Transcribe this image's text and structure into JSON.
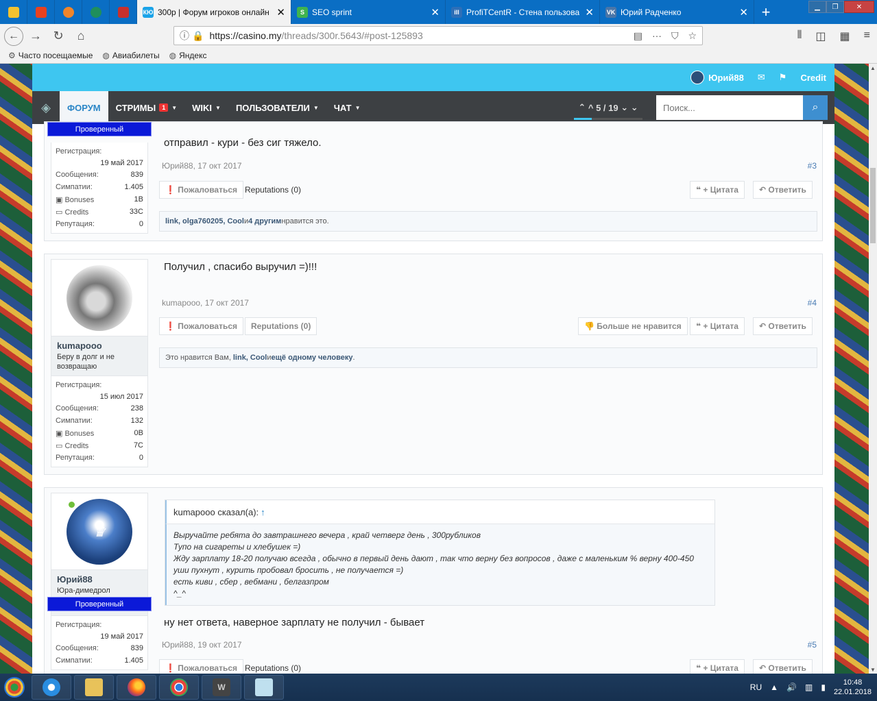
{
  "browser": {
    "tabs": [
      {
        "title": "300р | Форум игроков онлайн",
        "fav": "КЮ",
        "color": "#1aa3e8",
        "active": true
      },
      {
        "title": "SEO sprint",
        "fav": "S",
        "color": "#3fb34f",
        "active": false
      },
      {
        "title": "ProfiTCentR - Стена пользоват",
        "fav": "ill",
        "color": "#2e6fb7",
        "active": false
      },
      {
        "title": "Юрий Радченко",
        "fav": "VK",
        "color": "#4a76a8",
        "active": false
      }
    ],
    "url_host": "https://casino.my",
    "url_path": "/threads/300r.5643/#post-125893",
    "bookmarks": [
      "Часто посещаемые",
      "Авиабилеты",
      "Яндекс"
    ]
  },
  "topbar": {
    "username": "Юрий88",
    "credit": "Credit"
  },
  "menu": {
    "items": [
      {
        "label": "Форум",
        "active": true,
        "badge": "",
        "caret": false
      },
      {
        "label": "Стримы",
        "active": false,
        "badge": "1",
        "caret": true
      },
      {
        "label": "Wiki",
        "active": false,
        "badge": "",
        "caret": true
      },
      {
        "label": "Пользователи",
        "active": false,
        "badge": "",
        "caret": true
      },
      {
        "label": "Чат",
        "active": false,
        "badge": "",
        "caret": true
      }
    ],
    "pager": "5 / 19",
    "pager_progress": 0.26,
    "search_placeholder": "Поиск..."
  },
  "labels": {
    "registration": "Регистрация:",
    "messages": "Сообщения:",
    "likes": "Симпатии:",
    "bonuses": "Bonuses",
    "credits": "Credits",
    "reputation": "Репутация:",
    "report": "Пожаловаться",
    "quote": "+ Цитата",
    "reply": "Ответить",
    "unlike": "Больше не нравится",
    "verified": "Проверенный"
  },
  "posts": [
    {
      "id": "p3",
      "text": "отправил - кури - без сиг тяжело.",
      "author": "Юрий88",
      "date": "17 окт 2017",
      "num": "#3",
      "reputations": "Reputations (0)",
      "likes": {
        "pre": "",
        "names": "link, olga760205, Cool",
        "mid": " и ",
        "others": "4 другим",
        "post": " нравится это."
      },
      "stats": {
        "reg": "19 май 2017",
        "msgs": "839",
        "likes": "1.405",
        "bonuses": "1B",
        "credits": "33C",
        "rep": "0"
      }
    },
    {
      "id": "p4",
      "text": "Получил , спасибо выручил =)!!!",
      "author": "kumapooo",
      "user_title": "Беру в долг и не возвращаю",
      "date": "17 окт 2017",
      "num": "#4",
      "reputations": "Reputations (0)",
      "likes": {
        "pre": "Это нравится Вам, ",
        "names": "link, Cool",
        "mid": " и ",
        "others": "ещё одному человеку",
        "post": "."
      },
      "stats": {
        "reg": "15 июл 2017",
        "msgs": "238",
        "likes": "132",
        "bonuses": "0B",
        "credits": "7C",
        "rep": "0"
      }
    },
    {
      "id": "p5",
      "text": "ну нет ответа, наверное зарплату не получил - бывает",
      "author": "Юрий88",
      "user_title": "Юра-димедрол",
      "date": "19 окт 2017",
      "num": "#5",
      "reputations": "Reputations (0)",
      "quote_head": "kumapooo сказал(а):",
      "quote_lines": [
        "Выручайте ребята до завтрашнего вечера , край четверг день , 300рубликов",
        "Тупо на сигареты и хлебушек =)",
        "Жду зарплату 18-20 получаю всегда , обычно в первый день дают , так что верну без вопросов , даже с маленьким % верну 400-450",
        "уши пухнут , курить пробовал бросить , не получается =)",
        "есть киви , сбер , вебмани , белгазпром",
        "^_^"
      ],
      "stats": {
        "reg": "19 май 2017",
        "msgs": "839",
        "likes": "1.405"
      }
    }
  ],
  "tray": {
    "lang": "RU",
    "time": "10:48",
    "date": "22.01.2018"
  }
}
